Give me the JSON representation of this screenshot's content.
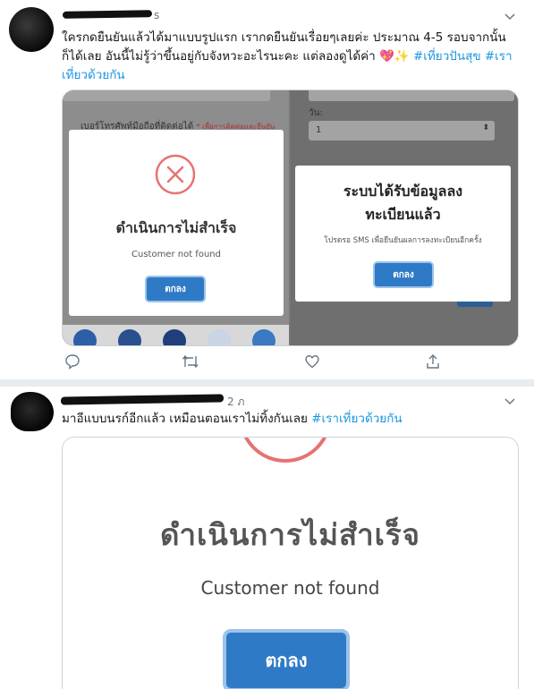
{
  "tweets": [
    {
      "time_tail": "s",
      "text_main": "ใครกดยืนยันแล้วได้มาแบบรูปแรก เรากดยืนยันเรื่อยๆเลยค่ะ ประมาณ 4-5 รอบจากนั้นก็ได้เลย อันนี้ไม่รู้ว่าขึ้นอยู่กับจังหวะอะไรนะคะ แต่ลองดูได้ค่า",
      "emoji": "💖✨",
      "hashtags": [
        "#เที่ยวปันสุข",
        "#เราเที่ยวด้วยกัน"
      ],
      "media": {
        "left_panel": {
          "bg_label": "เบอร์โทรศัพท์มือถือที่ติดต่อได้",
          "bg_label_note": "* เพื่อการติดต่อและยืนยัน",
          "modal_title": "ดำเนินการไม่สำเร็จ",
          "modal_message": "Customer not found",
          "button_label": "ตกลง"
        },
        "right_panel": {
          "bg_label": "วัน:",
          "select_value": "1",
          "modal_title_line1": "ระบบได้รับข้อมูลลง",
          "modal_title_line2": "ทะเบียนแล้ว",
          "modal_message": "โปรดรอ SMS เพื่อยืนยันผลการลงทะเบียนอีกครั้ง",
          "button_label": "ตกลง"
        }
      },
      "actions": [
        "reply-icon",
        "retweet-icon",
        "like-icon",
        "share-icon"
      ]
    },
    {
      "time_tail": "2 ภ",
      "text_main": "มาอีแบบนรก์อีกแล้ว เหมือนตอนเราไม่ทิ้งกันเลย",
      "hashtag": "#เราเที่ยวด้วยกัน",
      "media": {
        "modal_title": "ดำเนินการไม่สำเร็จ",
        "modal_message": "Customer not found",
        "button_label": "ตกลง"
      }
    }
  ],
  "colors": {
    "link": "#1b95e0",
    "button": "#2f7ac6",
    "error_red": "#e57373",
    "separator": "#e6ecf0"
  }
}
